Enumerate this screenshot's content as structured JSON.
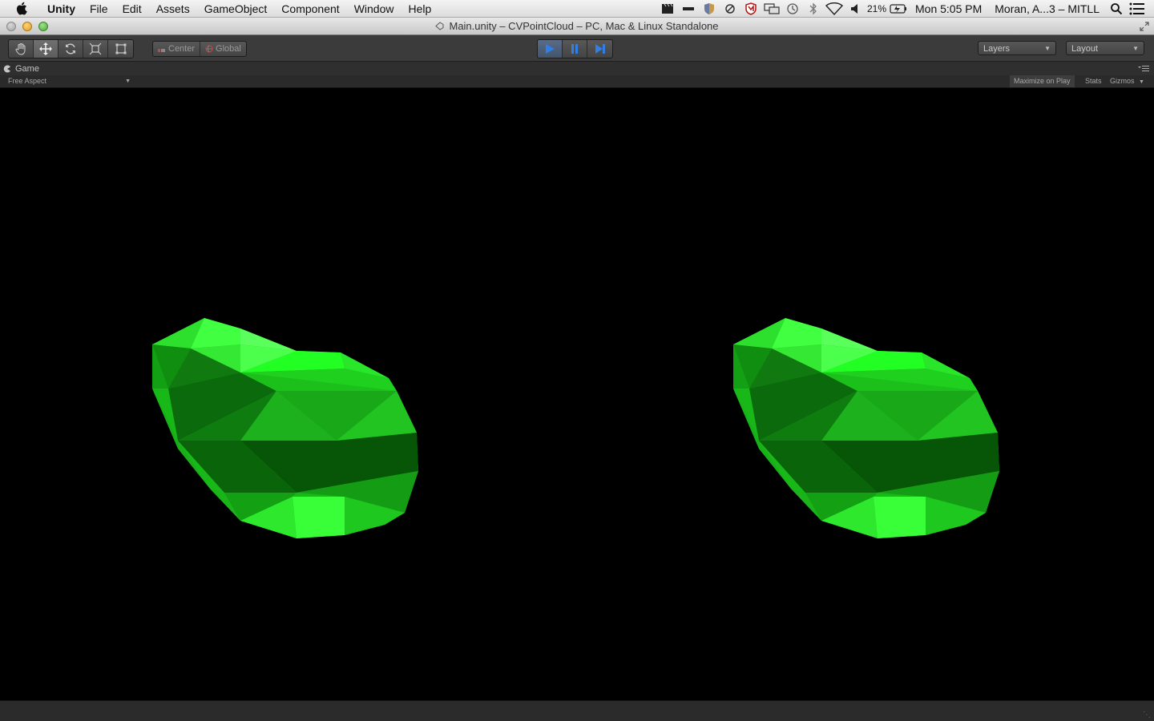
{
  "menubar": {
    "items": [
      "Unity",
      "File",
      "Edit",
      "Assets",
      "GameObject",
      "Component",
      "Window",
      "Help"
    ],
    "battery": "21%",
    "clock": "Mon 5:05 PM",
    "user": "Moran, A...3 – MITLL"
  },
  "window": {
    "title": "Main.unity – CVPointCloud – PC, Mac & Linux Standalone"
  },
  "toolbar": {
    "pivot_label": "Center",
    "space_label": "Global",
    "layers_label": "Layers",
    "layout_label": "Layout"
  },
  "game_panel": {
    "tab_label": "Game",
    "aspect": "Free Aspect",
    "maximize_label": "Maximize on Play",
    "stats_label": "Stats",
    "gizmos_label": "Gizmos"
  },
  "colors": {
    "accent_play": "#2f7fe6",
    "mesh_green": "#14ff14"
  }
}
